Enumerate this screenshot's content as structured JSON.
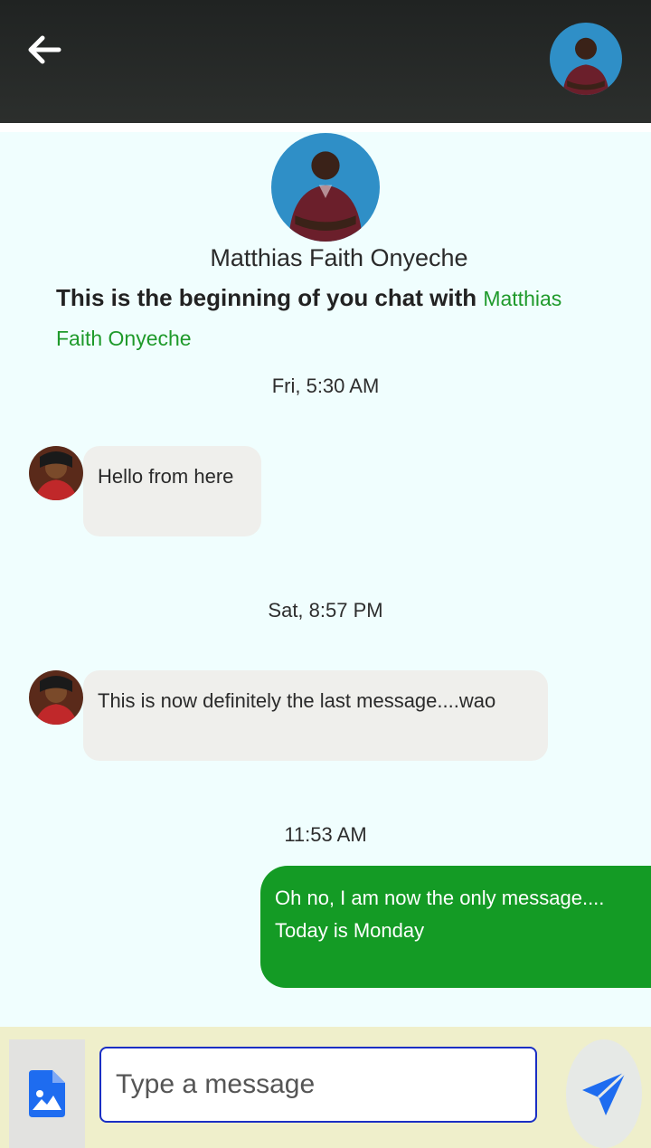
{
  "header": {
    "back_icon": "arrow-left-icon",
    "avatar_alt": "contact-avatar"
  },
  "profile": {
    "name": "Matthias Faith Onyeche",
    "intro_lead": "This is the beginning of you chat with",
    "intro_name": "Matthias Faith Onyeche"
  },
  "messages": [
    {
      "time": "Fri, 5:30 AM",
      "text": "Hello from here",
      "direction": "incoming"
    },
    {
      "time": "Sat, 8:57 PM",
      "text": "This is now definitely the last message....wao",
      "direction": "incoming"
    },
    {
      "time": "11:53 AM",
      "text": "Oh no, I am now the only message.... Today is Monday",
      "direction": "outgoing"
    }
  ],
  "composer": {
    "placeholder": "Type a message",
    "value": "",
    "attach_icon": "image-file-icon",
    "send_icon": "send-icon"
  },
  "colors": {
    "topbar": "#2a2d2b",
    "background": "#f0fefe",
    "outgoing_bubble": "#149b25",
    "incoming_bubble": "#efefec",
    "accent_name": "#1f9a2b",
    "composer_bg": "#efefcb",
    "input_border": "#1a2fc4",
    "icon_blue": "#1e6cf0"
  }
}
